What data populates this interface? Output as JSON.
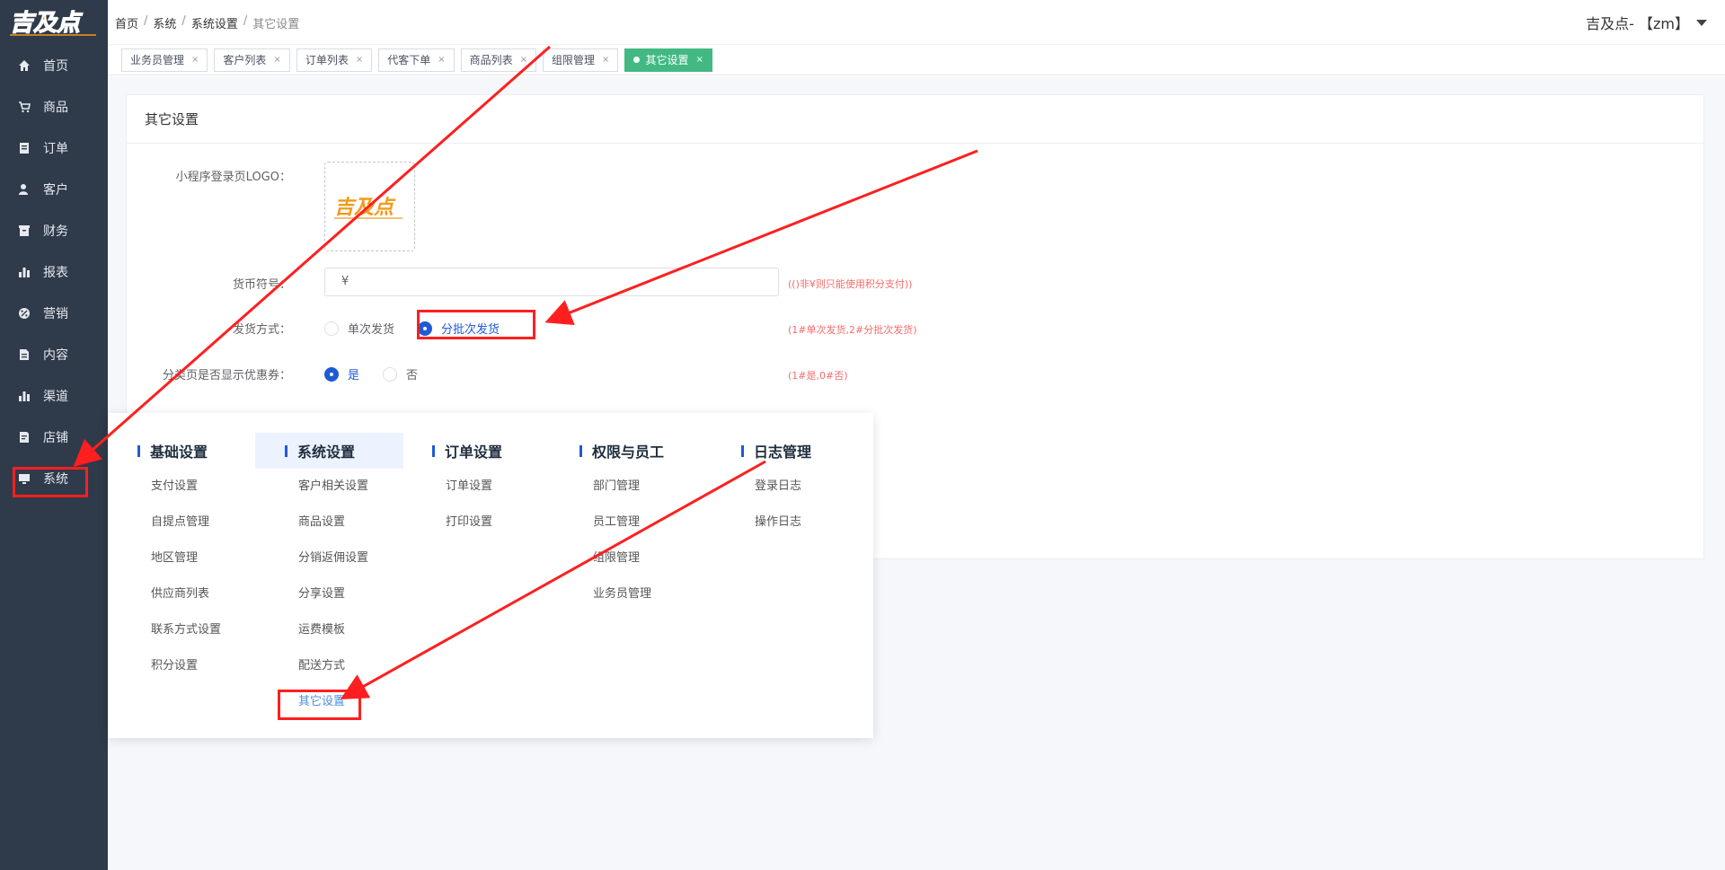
{
  "brand": {
    "logo_text": "吉及点"
  },
  "sidebar": {
    "items": [
      {
        "label": "首页",
        "icon": "home-icon"
      },
      {
        "label": "商品",
        "icon": "cart-icon"
      },
      {
        "label": "订单",
        "icon": "order-icon"
      },
      {
        "label": "客户",
        "icon": "user-icon"
      },
      {
        "label": "财务",
        "icon": "finance-icon"
      },
      {
        "label": "报表",
        "icon": "chart-icon"
      },
      {
        "label": "营销",
        "icon": "percent-icon"
      },
      {
        "label": "内容",
        "icon": "document-icon"
      },
      {
        "label": "渠道",
        "icon": "chart-icon"
      },
      {
        "label": "店铺",
        "icon": "store-icon"
      },
      {
        "label": "系统",
        "icon": "monitor-icon"
      }
    ]
  },
  "header": {
    "breadcrumb": [
      "首页",
      "系统",
      "系统设置",
      "其它设置"
    ],
    "user_label": "吉及点- 【zm】"
  },
  "tabs": [
    {
      "label": "业务员管理"
    },
    {
      "label": "客户列表"
    },
    {
      "label": "订单列表"
    },
    {
      "label": "代客下单"
    },
    {
      "label": "商品列表"
    },
    {
      "label": "组限管理"
    },
    {
      "label": "其它设置",
      "active": true
    }
  ],
  "card": {
    "title": "其它设置",
    "logo_label": "小程序登录页LOGO：",
    "currency_label": "货币符号：",
    "currency_value": "¥",
    "currency_hint": "(()非¥则只能使用积分支付))",
    "ship_label": "发货方式：",
    "ship_options": [
      "单次发货",
      "分批次发货"
    ],
    "ship_hint": "(1#单次发货,2#分批次发货)",
    "coupon_label": "分类页是否显示优惠券：",
    "coupon_options": [
      "是",
      "否"
    ],
    "coupon_hint": "(1#是,0#否)"
  },
  "mega_menu": {
    "columns": [
      {
        "title": "基础设置",
        "items": [
          "支付设置",
          "自提点管理",
          "地区管理",
          "供应商列表",
          "联系方式设置",
          "积分设置"
        ]
      },
      {
        "title": "系统设置",
        "items": [
          "客户相关设置",
          "商品设置",
          "分销返佣设置",
          "分享设置",
          "运费模板",
          "配送方式",
          "其它设置"
        ]
      },
      {
        "title": "订单设置",
        "items": [
          "订单设置",
          "打印设置"
        ]
      },
      {
        "title": "权限与员工",
        "items": [
          "部门管理",
          "员工管理",
          "组限管理",
          "业务员管理"
        ]
      },
      {
        "title": "日志管理",
        "items": [
          "登录日志",
          "操作日志"
        ]
      }
    ]
  },
  "colors": {
    "sidebar_bg": "#2f3a4a",
    "accent": "#1f5ad6",
    "tab_active": "#42b983",
    "annotation_red": "#ff1f1f"
  }
}
